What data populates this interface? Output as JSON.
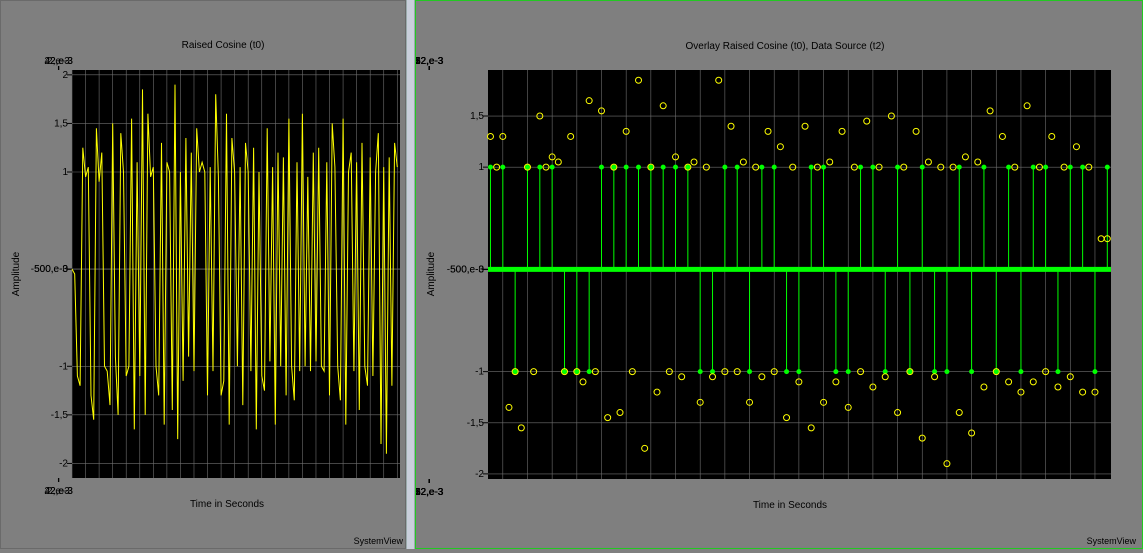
{
  "left": {
    "title": "Raised Cosine (t0)",
    "xlabel": "Time in Seconds",
    "ylabel": "Amplitude",
    "brand": "SystemView",
    "xticks": [
      "2,e-3",
      "22,e-3",
      "42,e-3"
    ],
    "yticks": [
      "2",
      "1,5",
      "1",
      "500,e-3",
      "0",
      "-500,e-3",
      "-1",
      "-1,5",
      "-2"
    ]
  },
  "right": {
    "title": "Overlay Raised Cosine (t0), Data Source (t2)",
    "xlabel": "Time in Seconds",
    "ylabel": "Amplitude",
    "brand": "SystemView",
    "xticks": [
      "12,e-3",
      "22,e-3",
      "32,e-3",
      "42,e-3",
      "52,e-3"
    ],
    "yticks": [
      "1,5",
      "1",
      "500,e-3",
      "0",
      "-500,e-3",
      "-1",
      "-1,5",
      "-2"
    ]
  },
  "chart_data": [
    {
      "type": "line",
      "title": "Raised Cosine (t0)",
      "xlabel": "Time in Seconds",
      "ylabel": "Amplitude",
      "xlim": [
        0.002,
        0.0504
      ],
      "ylim": [
        -2.15,
        2.05
      ],
      "grid": true,
      "series": [
        {
          "color": "#ffff00",
          "x": [
            0.002,
            0.0024,
            0.0028,
            0.0032,
            0.0036,
            0.004,
            0.0044,
            0.0048,
            0.0052,
            0.0056,
            0.006,
            0.0064,
            0.0068,
            0.0072,
            0.0076,
            0.008,
            0.0084,
            0.0088,
            0.0092,
            0.0096,
            0.01,
            0.0104,
            0.0108,
            0.0112,
            0.0116,
            0.012,
            0.0124,
            0.0128,
            0.0132,
            0.0136,
            0.014,
            0.0144,
            0.0148,
            0.0152,
            0.0156,
            0.016,
            0.0164,
            0.0168,
            0.0172,
            0.0176,
            0.018,
            0.0184,
            0.0188,
            0.0192,
            0.0196,
            0.02,
            0.0204,
            0.0208,
            0.0212,
            0.0216,
            0.022,
            0.0224,
            0.0228,
            0.0232,
            0.0236,
            0.024,
            0.0244,
            0.0248,
            0.0252,
            0.0256,
            0.026,
            0.0264,
            0.0268,
            0.0272,
            0.0276,
            0.028,
            0.0284,
            0.0288,
            0.0292,
            0.0296,
            0.03,
            0.0304,
            0.0308,
            0.0312,
            0.0316,
            0.032,
            0.0324,
            0.0328,
            0.0332,
            0.0336,
            0.034,
            0.0344,
            0.0348,
            0.0352,
            0.0356,
            0.036,
            0.0364,
            0.0368,
            0.0372,
            0.0376,
            0.038,
            0.0384,
            0.0388,
            0.0392,
            0.0396,
            0.04,
            0.0404,
            0.0408,
            0.0412,
            0.0416,
            0.042,
            0.0424,
            0.0428,
            0.0432,
            0.0436,
            0.044,
            0.0444,
            0.0448,
            0.0452,
            0.0456,
            0.046,
            0.0464,
            0.0468,
            0.0472,
            0.0476,
            0.048,
            0.0484,
            0.0488,
            0.0492,
            0.0496,
            0.05
          ],
          "y": [
            0,
            -0.05,
            -1.1,
            -1.2,
            1.25,
            0.95,
            1.05,
            -1.3,
            -1.55,
            1.45,
            0.9,
            1.2,
            -1.0,
            -1.05,
            -1.4,
            1.5,
            -0.9,
            -1.5,
            1.4,
            1.0,
            -1.1,
            -1.0,
            1.55,
            -1.65,
            1.1,
            -1.1,
            1.85,
            -1.5,
            1.6,
            0.95,
            1.05,
            -1.0,
            -1.3,
            1.3,
            -1.6,
            1.1,
            1.0,
            -1.45,
            1.9,
            -1.75,
            1.0,
            -1.15,
            1.35,
            -0.9,
            1.2,
            -1.05,
            1.45,
            1.0,
            1.1,
            1.0,
            -1.3,
            1.05,
            -1.05,
            1.8,
            0.95,
            -1.3,
            -1.15,
            1.6,
            -1.6,
            1.35,
            1.0,
            -1.0,
            1.05,
            -1.4,
            1.3,
            1.0,
            -1.05,
            1.25,
            -1.65,
            1.0,
            -1.1,
            -1.25,
            1.45,
            -0.95,
            1.05,
            -1.6,
            1.2,
            -1.0,
            1.15,
            -1.3,
            1.55,
            -1.0,
            -1.35,
            1.1,
            -1.05,
            1.6,
            -1.0,
            0.95,
            -1.05,
            1.2,
            -0.95,
            1.25,
            -1.0,
            -1.05,
            1.1,
            -1.3,
            1.5,
            1.05,
            -1.0,
            -1.35,
            1.55,
            -1.6,
            1.0,
            1.2,
            -1.05,
            1.1,
            -1.45,
            1.3,
            -1.0,
            -1.2,
            1.15,
            -1.1,
            1.0,
            1.4,
            -1.8,
            1.05,
            -1.9,
            1.15,
            -1.2,
            1.3,
            1.05
          ]
        }
      ]
    },
    {
      "type": "line",
      "title": "Overlay Raised Cosine (t0), Data Source (t2)",
      "xlabel": "Time in Seconds",
      "ylabel": "Amplitude",
      "xlim": [
        0.0048,
        0.0553
      ],
      "ylim": [
        -2.05,
        1.95
      ],
      "grid": true,
      "series": [
        {
          "color": "#ffff00",
          "marker": "circle",
          "x": [
            0.005,
            0.0055,
            0.006,
            0.0065,
            0.007,
            0.0075,
            0.008,
            0.0085,
            0.009,
            0.0095,
            0.01,
            0.0105,
            0.011,
            0.0115,
            0.012,
            0.0125,
            0.013,
            0.0135,
            0.014,
            0.0145,
            0.015,
            0.0155,
            0.016,
            0.0165,
            0.017,
            0.0175,
            0.018,
            0.0185,
            0.019,
            0.0195,
            0.02,
            0.0205,
            0.021,
            0.0215,
            0.022,
            0.0225,
            0.023,
            0.0235,
            0.024,
            0.0245,
            0.025,
            0.0255,
            0.026,
            0.0265,
            0.027,
            0.0275,
            0.028,
            0.0285,
            0.029,
            0.0295,
            0.03,
            0.0305,
            0.031,
            0.0315,
            0.032,
            0.0325,
            0.033,
            0.0335,
            0.034,
            0.0345,
            0.035,
            0.0355,
            0.036,
            0.0365,
            0.037,
            0.0375,
            0.038,
            0.0385,
            0.039,
            0.0395,
            0.04,
            0.0405,
            0.041,
            0.0415,
            0.042,
            0.0425,
            0.043,
            0.0435,
            0.044,
            0.0445,
            0.045,
            0.0455,
            0.046,
            0.0465,
            0.047,
            0.0475,
            0.048,
            0.0485,
            0.049,
            0.0495,
            0.05,
            0.0505,
            0.051,
            0.0515,
            0.052,
            0.0525,
            0.053,
            0.0535,
            0.054,
            0.0545,
            0.055
          ],
          "y": [
            1.3,
            1.0,
            1.3,
            -1.35,
            -1.0,
            -1.55,
            1.0,
            -1.0,
            1.5,
            1.0,
            1.1,
            1.05,
            -1.0,
            1.3,
            -1.0,
            -1.1,
            1.65,
            -1.0,
            1.55,
            -1.45,
            1.0,
            -1.4,
            1.35,
            -1.0,
            1.85,
            -1.75,
            1.0,
            -1.2,
            1.6,
            -1.0,
            1.1,
            -1.05,
            1.0,
            1.05,
            -1.3,
            1.0,
            -1.05,
            1.85,
            -1.0,
            1.4,
            -1.0,
            1.05,
            -1.3,
            1.0,
            -1.05,
            1.35,
            -1.0,
            1.2,
            -1.45,
            1.0,
            -1.1,
            1.4,
            -1.55,
            1.0,
            -1.3,
            1.05,
            -1.1,
            1.35,
            -1.35,
            1.0,
            -1.0,
            1.45,
            -1.15,
            1.0,
            -1.05,
            1.5,
            -1.4,
            1.0,
            -1.0,
            1.35,
            -1.65,
            1.05,
            -1.05,
            1.0,
            -1.9,
            1.0,
            -1.4,
            1.1,
            -1.6,
            1.05,
            -1.15,
            1.55,
            -1.0,
            1.3,
            -1.1,
            1.0,
            -1.2,
            1.6,
            -1.1,
            1.0,
            -1.0,
            1.3,
            -1.15,
            1.0,
            -1.05,
            1.2,
            -1.2,
            1.0,
            -1.2,
            0.3,
            0.3
          ]
        },
        {
          "color": "#00ff00",
          "style": "stem",
          "x": [
            0.005,
            0.006,
            0.007,
            0.008,
            0.009,
            0.01,
            0.011,
            0.012,
            0.013,
            0.014,
            0.015,
            0.016,
            0.017,
            0.018,
            0.019,
            0.02,
            0.021,
            0.022,
            0.023,
            0.024,
            0.025,
            0.026,
            0.027,
            0.028,
            0.029,
            0.03,
            0.031,
            0.032,
            0.033,
            0.034,
            0.035,
            0.036,
            0.037,
            0.038,
            0.039,
            0.04,
            0.041,
            0.042,
            0.043,
            0.044,
            0.045,
            0.046,
            0.047,
            0.048,
            0.049,
            0.05,
            0.051,
            0.052,
            0.053,
            0.054,
            0.055
          ],
          "y": [
            1,
            1,
            -1,
            1,
            1,
            1,
            -1,
            -1,
            -1,
            1,
            1,
            1,
            1,
            1,
            1,
            1,
            1,
            -1,
            -1,
            1,
            1,
            -1,
            1,
            1,
            -1,
            -1,
            1,
            1,
            -1,
            -1,
            1,
            1,
            -1,
            1,
            -1,
            1,
            -1,
            -1,
            1,
            -1,
            1,
            -1,
            1,
            -1,
            1,
            1,
            -1,
            1,
            1,
            -1,
            1
          ]
        }
      ]
    }
  ]
}
